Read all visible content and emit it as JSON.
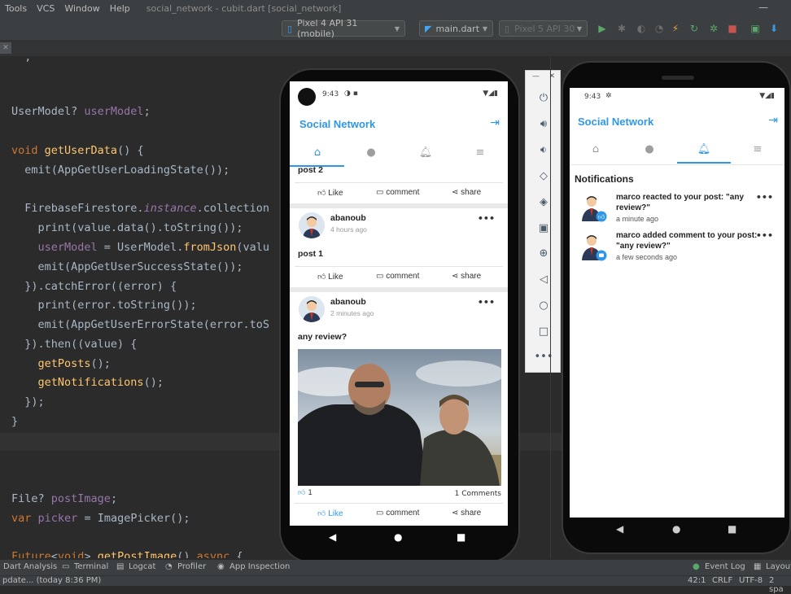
{
  "ide": {
    "menu": [
      "Tools",
      "VCS",
      "Window",
      "Help"
    ],
    "title": "social_network - cubit.dart [social_network]",
    "device_combo": "Pixel 4 API 31 (mobile)",
    "file_combo": "main.dart",
    "second_device_combo": "Pixel 5 API 30",
    "code_lines": [
      {
        "row": "l0",
        "text": "  ;"
      },
      {
        "row": "l1",
        "text": "UserModel? userModel;"
      },
      {
        "row": "l2",
        "text": "void getUserData() {"
      },
      {
        "row": "l3",
        "text": "  emit(AppGetUserLoadingState());"
      },
      {
        "row": "l4",
        "text": "  FirebaseFirestore.instance.collection"
      },
      {
        "row": "l5",
        "text": "    print(value.data().toString());"
      },
      {
        "row": "l6",
        "text": "    userModel = UserModel.fromJson(valu"
      },
      {
        "row": "l7",
        "text": "    emit(AppGetUserSuccessState());"
      },
      {
        "row": "l8",
        "text": "  }).catchError((error) {"
      },
      {
        "row": "l9",
        "text": "    print(error.toString());"
      },
      {
        "row": "l10",
        "text": "    emit(AppGetUserErrorState(error.toS"
      },
      {
        "row": "l11",
        "text": "  }).then((value) {"
      },
      {
        "row": "l12",
        "text": "    getPosts();"
      },
      {
        "row": "l13",
        "text": "    getNotifications();"
      },
      {
        "row": "l14",
        "text": "  });"
      },
      {
        "row": "l15",
        "text": "}"
      },
      {
        "row": "l16",
        "text": "File? postImage;"
      },
      {
        "row": "l17",
        "text": "var picker = ImagePicker();"
      },
      {
        "row": "l18",
        "text": "Future<void> getPostImage() async {"
      }
    ],
    "toolwindows": {
      "dart_analysis": "Dart Analysis",
      "terminal": "Terminal",
      "logcat": "Logcat",
      "profiler": "Profiler",
      "app_inspection": "App Inspection",
      "event_log": "Event Log",
      "layout": "Layout"
    },
    "status": {
      "left": "pdate... (today 8:36 PM)",
      "position": "42:1",
      "line_sep": "CRLF",
      "encoding": "UTF-8",
      "indent": "2 spa"
    }
  },
  "phone1": {
    "time": "9:43",
    "app_title": "Social Network",
    "partial_post_text": "post 2",
    "actions": {
      "like": "Like",
      "comment": "comment",
      "share": "share"
    },
    "posts": [
      {
        "author": "abanoub",
        "time": "4 hours ago",
        "text": "post 1"
      },
      {
        "author": "abanoub",
        "time": "2 minutes ago",
        "text": "any review?",
        "likes": "1",
        "comments": "1 Comments"
      }
    ]
  },
  "phone2": {
    "time": "9:43",
    "app_title": "Social Network",
    "section_title": "Notifications",
    "notifications": [
      {
        "text": "marco reacted to your post: \"any review?\"",
        "time": "a minute ago"
      },
      {
        "text": "marco added comment to your post: \"any review?\"",
        "time": "a few seconds ago"
      }
    ]
  },
  "colors": {
    "accent": "#2f97e6",
    "ide_bg": "#2b2b2b"
  }
}
